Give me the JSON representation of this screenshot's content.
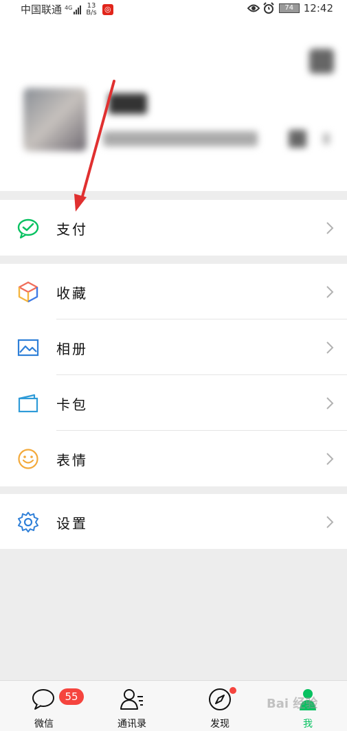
{
  "status_bar": {
    "carrier": "中国联通",
    "network": "4G",
    "speed_value": "13",
    "speed_unit": "B/s",
    "battery": "74",
    "time": "12:42"
  },
  "menu": {
    "pay": {
      "label": "支付",
      "icon": "wechat-pay-icon"
    },
    "favorites": {
      "label": "收藏",
      "icon": "cube-icon"
    },
    "album": {
      "label": "相册",
      "icon": "picture-icon"
    },
    "cards": {
      "label": "卡包",
      "icon": "wallet-card-icon"
    },
    "stickers": {
      "label": "表情",
      "icon": "smiley-icon"
    },
    "settings": {
      "label": "设置",
      "icon": "gear-icon"
    }
  },
  "tabbar": {
    "chats": {
      "label": "微信",
      "badge": "55"
    },
    "contacts": {
      "label": "通讯录"
    },
    "discover": {
      "label": "发现"
    },
    "me": {
      "label": "我"
    }
  },
  "watermark": "Bai 经验",
  "colors": {
    "accent_green": "#07c160",
    "badge_red": "#f5443e",
    "annotation_red": "#e03030"
  }
}
